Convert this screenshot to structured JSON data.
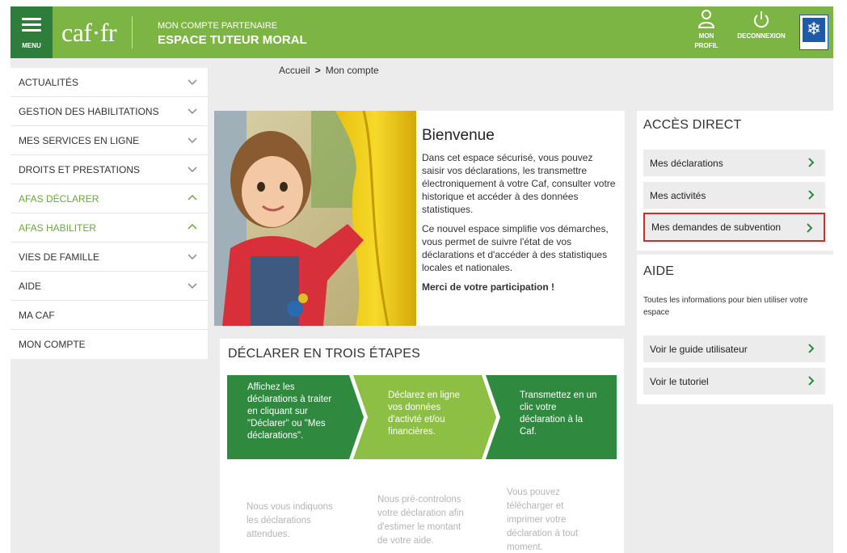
{
  "header": {
    "menu_label": "MENU",
    "logo": "caf·fr",
    "title_top": "MON COMPTE PARTENAIRE",
    "title_main": "ESPACE TUTEUR MORAL",
    "profil_label_1": "MON",
    "profil_label_2": "PROFIL",
    "logout_label": "DECONNEXION"
  },
  "sidebar": {
    "items": [
      {
        "label": "ACTUALITÉS"
      },
      {
        "label": "GESTION DES HABILITATIONS"
      },
      {
        "label": "MES SERVICES EN LIGNE"
      },
      {
        "label": "DROITS ET PRESTATIONS"
      },
      {
        "label": "AFAS DÉCLARER"
      },
      {
        "label": "AFAS HABILITER"
      },
      {
        "label": "VIES DE FAMILLE"
      },
      {
        "label": "AIDE"
      },
      {
        "label": "MA CAF"
      },
      {
        "label": "MON COMPTE"
      }
    ]
  },
  "breadcrumb": {
    "home": "Accueil",
    "separator": ">",
    "current": "Mon compte"
  },
  "welcome": {
    "title": "Bienvenue",
    "p1": "Dans cet espace sécurisé, vous pouvez saisir vos déclarations, les transmettre électroniquement à votre Caf, consulter votre historique et accéder à des données statistiques.",
    "p2": "Ce nouvel espace simplifie vos démarches, vous permet de suivre l'état de vos déclarations et d'accéder à des statistiques locales et nationales.",
    "thanks": "Merci de votre participation !"
  },
  "steps": {
    "title": "DÉCLARER EN TROIS ÉTAPES",
    "step1_l1": "Affichez les",
    "step1_l2": "déclarations à traiter",
    "step1_l3": "en cliquant sur",
    "step1_l4": "\"Déclarer\" ou \"Mes",
    "step1_l5": "déclarations\".",
    "step2_l1": "Déclarez en ligne",
    "step2_l2": "vos données",
    "step2_l3": "d'activté et/ou",
    "step2_l4": "financières.",
    "step3_l1": "Transmettez en un",
    "step3_l2": "clic votre",
    "step3_l3": "déclaration à la",
    "step3_l4": "Caf.",
    "desc1_l1": "Nous vous indiquons",
    "desc1_l2": "les déclarations",
    "desc1_l3": "attendues.",
    "desc2_l1": "Nous pré-controlons",
    "desc2_l2": "votre déclaration afin",
    "desc2_l3": "d'estimer le montant",
    "desc2_l4": "de votre aide.",
    "desc3_l1": "Vous pouvez",
    "desc3_l2": "télécharger et",
    "desc3_l3": "imprimer votre",
    "desc3_l4": "déclaration à tout",
    "desc3_l5": "moment."
  },
  "acces_direct": {
    "title": "ACCÈS DIRECT",
    "links": [
      {
        "label": "Mes déclarations"
      },
      {
        "label": "Mes activités"
      },
      {
        "label": "Mes demandes de subvention"
      }
    ]
  },
  "aide": {
    "title": "AIDE",
    "description": "Toutes les informations pour bien utiliser votre espace",
    "links": [
      {
        "label": "Voir le guide utilisateur"
      },
      {
        "label": "Voir le tutoriel"
      }
    ]
  },
  "colors": {
    "header_green": "#7db544",
    "menu_dark_green": "#2f7d3a",
    "step_dark_green": "#2f8a3f",
    "step_light_green": "#8dbf45",
    "highlight_red": "#d42a2a"
  }
}
